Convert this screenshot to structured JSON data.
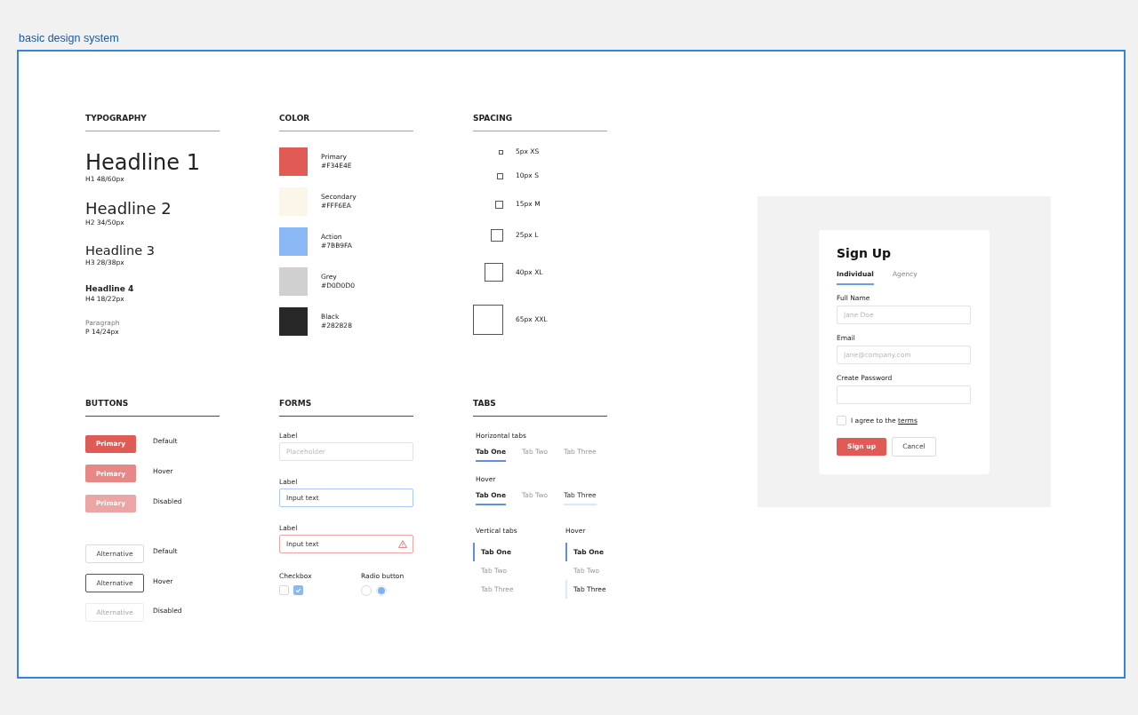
{
  "title": "basic design system",
  "typography": {
    "heading": "TYPOGRAPHY",
    "styles": [
      {
        "kind": "h1",
        "sample": "Headline 1",
        "spec": "H1 48/60px"
      },
      {
        "kind": "h2",
        "sample": "Headline 2",
        "spec": "H2 34/50px"
      },
      {
        "kind": "h3",
        "sample": "Headline 3",
        "spec": "H3 28/38px"
      },
      {
        "kind": "h4",
        "sample": "Headline 4",
        "spec": "H4 18/22px"
      },
      {
        "kind": "paragraph",
        "sample": "Paragraph",
        "spec": "P 14/24px"
      }
    ]
  },
  "color": {
    "heading": "COLOR",
    "swatches": [
      {
        "name": "Primary",
        "code": "#F34E4E",
        "color": "#e05a56"
      },
      {
        "name": "Secondary",
        "code": "#FFF6EA",
        "color": "#fcf6ea"
      },
      {
        "name": "Action",
        "code": "#7BB9FA",
        "color": "#8ab8f5"
      },
      {
        "name": "Grey",
        "code": "#D0D0D0",
        "color": "#d0d0d0"
      },
      {
        "name": "Black",
        "code": "#282828",
        "color": "#282828"
      }
    ]
  },
  "spacing": {
    "heading": "SPACING",
    "sizes": [
      {
        "kind": "xs",
        "label": "5px XS"
      },
      {
        "kind": "s",
        "label": "10px S"
      },
      {
        "kind": "m",
        "label": "15px M"
      },
      {
        "kind": "l",
        "label": "25px L"
      },
      {
        "kind": "xl",
        "label": "40px XL"
      },
      {
        "kind": "xxl",
        "label": "65px XXL"
      }
    ]
  },
  "buttons": {
    "heading": "BUTTONS",
    "groups": [
      {
        "kind": "primary",
        "rows": [
          {
            "label": "Primary",
            "state": "Default",
            "hover": false,
            "disabled": false
          },
          {
            "label": "Primary",
            "state": "Hover",
            "hover": true,
            "disabled": false
          },
          {
            "label": "Primary",
            "state": "Disabled",
            "hover": false,
            "disabled": true
          }
        ]
      },
      {
        "kind": "alternative",
        "rows": [
          {
            "label": "Alternative",
            "state": "Default",
            "hover": false,
            "disabled": false
          },
          {
            "label": "Alternative",
            "state": "Hover",
            "hover": true,
            "disabled": false
          },
          {
            "label": "Alternative",
            "state": "Disabled",
            "hover": false,
            "disabled": true
          }
        ]
      }
    ]
  },
  "forms": {
    "heading": "FORMS",
    "fields": [
      {
        "label": "Label",
        "placeholder": "Placeholder",
        "focused": false,
        "error": false
      },
      {
        "label": "Label",
        "value": "Input text",
        "focused": true,
        "error": false
      },
      {
        "label": "Label",
        "value": "Input text",
        "focused": false,
        "error": true
      }
    ],
    "checkbox": {
      "label": "Checkbox",
      "boxes": [
        {
          "checked": false
        },
        {
          "checked": true
        }
      ]
    },
    "radio": {
      "label": "Radio button",
      "options": [
        {
          "selected": false
        },
        {
          "selected": true
        }
      ]
    }
  },
  "tabs": {
    "heading": "TABS",
    "horizontal": [
      {
        "label": "Horizontal tabs",
        "tabs": [
          {
            "label": "Tab One",
            "selected": true,
            "hover": false
          },
          {
            "label": "Tab Two",
            "selected": false,
            "hover": false
          },
          {
            "label": "Tab Three",
            "selected": false,
            "hover": false
          }
        ]
      },
      {
        "label": "Hover",
        "tabs": [
          {
            "label": "Tab One",
            "selected": true,
            "hover": false
          },
          {
            "label": "Tab Two",
            "selected": false,
            "hover": false
          },
          {
            "label": "Tab Three",
            "selected": false,
            "hover": true
          }
        ]
      }
    ],
    "vertical": [
      {
        "label": "Vertical tabs",
        "tabs": [
          {
            "label": "Tab One",
            "selected": true,
            "hover": false
          },
          {
            "label": "Tab Two",
            "selected": false,
            "hover": false
          },
          {
            "label": "Tab Three",
            "selected": false,
            "hover": false
          }
        ]
      },
      {
        "label": "Hover",
        "tabs": [
          {
            "label": "Tab One",
            "selected": true,
            "hover": false
          },
          {
            "label": "Tab Two",
            "selected": false,
            "hover": false
          },
          {
            "label": "Tab Three",
            "selected": false,
            "hover": true
          }
        ]
      }
    ]
  },
  "signup": {
    "title": "Sign Up",
    "tabs": [
      {
        "label": "Individual",
        "selected": true
      },
      {
        "label": "Agency",
        "selected": false
      }
    ],
    "fields": [
      {
        "label": "Full Name",
        "placeholder": "Jane Doe"
      },
      {
        "label": "Email",
        "placeholder": "Jane@company.com"
      },
      {
        "label": "Create Password"
      }
    ],
    "agree": {
      "text": "I agree to the",
      "link": "terms",
      "checked": false
    },
    "buttons": [
      {
        "label": "Sign up",
        "kind": "primary"
      },
      {
        "label": "Cancel",
        "kind": "secondary"
      }
    ]
  }
}
